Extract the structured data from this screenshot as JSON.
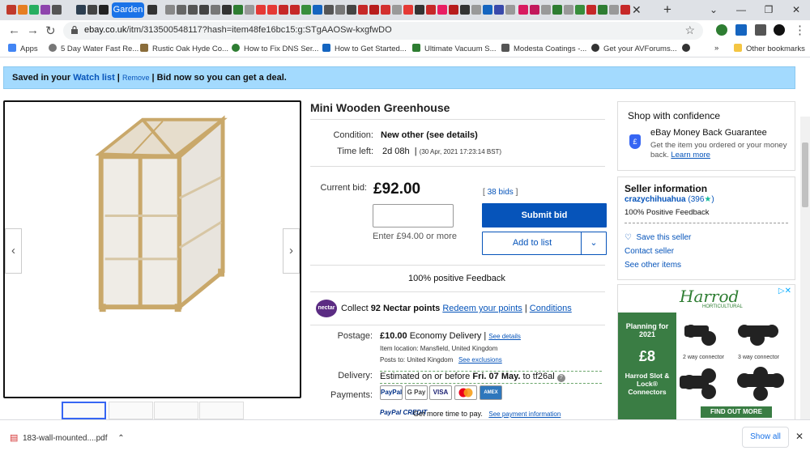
{
  "browser": {
    "active_tab_label": "Garden",
    "url_host": "ebay.co.uk",
    "url_path": "/itm/313500548117?hash=item48fe16bc15:g:STgAAOSw-kxgfwDO",
    "bookmarks": [
      {
        "label": "Apps",
        "color": "#4285f4"
      },
      {
        "label": "5 Day Water Fast Re...",
        "color": "#777777"
      },
      {
        "label": "Rustic Oak Hyde Co...",
        "color": "#8a6d3b"
      },
      {
        "label": "How to Fix DNS Ser...",
        "color": "#2e7d32"
      },
      {
        "label": "How to Get Started...",
        "color": "#1565c0"
      },
      {
        "label": "Ultimate Vacuum S...",
        "color": "#2e7d32"
      },
      {
        "label": "Modesta Coatings -...",
        "color": "#555555"
      },
      {
        "label": "Get your AVForums...",
        "color": "#333333"
      }
    ],
    "other_bookmarks": "Other bookmarks"
  },
  "banner": {
    "prefix": "Saved in your",
    "watch_link": "Watch list",
    "remove": "Remove",
    "suffix": "Bid now so you can get a deal."
  },
  "listing": {
    "title": "Mini Wooden Greenhouse",
    "condition_label": "Condition:",
    "condition_value": "New other (see details)",
    "time_left_label": "Time left:",
    "time_left_value": "2d 08h",
    "time_left_date": "(30 Apr, 2021   17:23:14 BST)",
    "current_bid_label": "Current bid:",
    "current_bid_value": "£92.00",
    "bids_count": "38 bids",
    "bid_hint": "Enter £94.00 or more",
    "submit_bid": "Submit bid",
    "add_to_list": "Add to list",
    "positive_feedback": "100% positive Feedback",
    "nectar_logo": "nectar",
    "nectar_text": "Collect",
    "nectar_points": "92 Nectar points",
    "nectar_redeem": "Redeem your points",
    "nectar_conditions": "Conditions",
    "postage_label": "Postage:",
    "postage_price": "£10.00",
    "postage_service": "Economy Delivery",
    "postage_details": "See details",
    "item_location": "Item location:   Mansfield, United Kingdom",
    "posts_to": "Posts to:   United Kingdom",
    "see_exclusions": "See exclusions",
    "delivery_label": "Delivery:",
    "delivery_prefix": "Estimated on or before",
    "delivery_date": "Fri. 07 May.",
    "delivery_to": "to",
    "delivery_postcode": "tf26al",
    "payments_label": "Payments:",
    "payments": [
      "PayPal",
      "G Pay",
      "VISA",
      "MC",
      "AMEX"
    ],
    "paypal_credit": "PayPal CREDIT",
    "credit_text": "Get more time to pay.",
    "credit_link": "See payment information"
  },
  "confidence": {
    "heading": "Shop with confidence",
    "guarantee_title": "eBay Money Back Guarantee",
    "guarantee_text": "Get the item you ordered or your money back.",
    "learn_more": "Learn more"
  },
  "seller": {
    "heading": "Seller information",
    "name": "crazychihuahua",
    "score": "(396",
    "feedback": "100% Positive Feedback",
    "save": "Save this seller",
    "contact": "Contact seller",
    "other_items": "See other items"
  },
  "ad": {
    "brand": "Harrod",
    "brand_sub": "HORTICULTURAL",
    "planning": "Planning for 2021",
    "price": "£8",
    "product": "Harrod Slot & Lock® Connectors",
    "connector1": "2 way connector",
    "connector2": "3 way connector",
    "cta": "FIND OUT MORE"
  },
  "downloads": {
    "file": "183-wall-mounted....pdf",
    "show_all": "Show all"
  },
  "colors": {
    "ebay_blue": "#0654ba",
    "banner_bg": "#a3dafe",
    "chrome_blue": "#1a73e8"
  }
}
